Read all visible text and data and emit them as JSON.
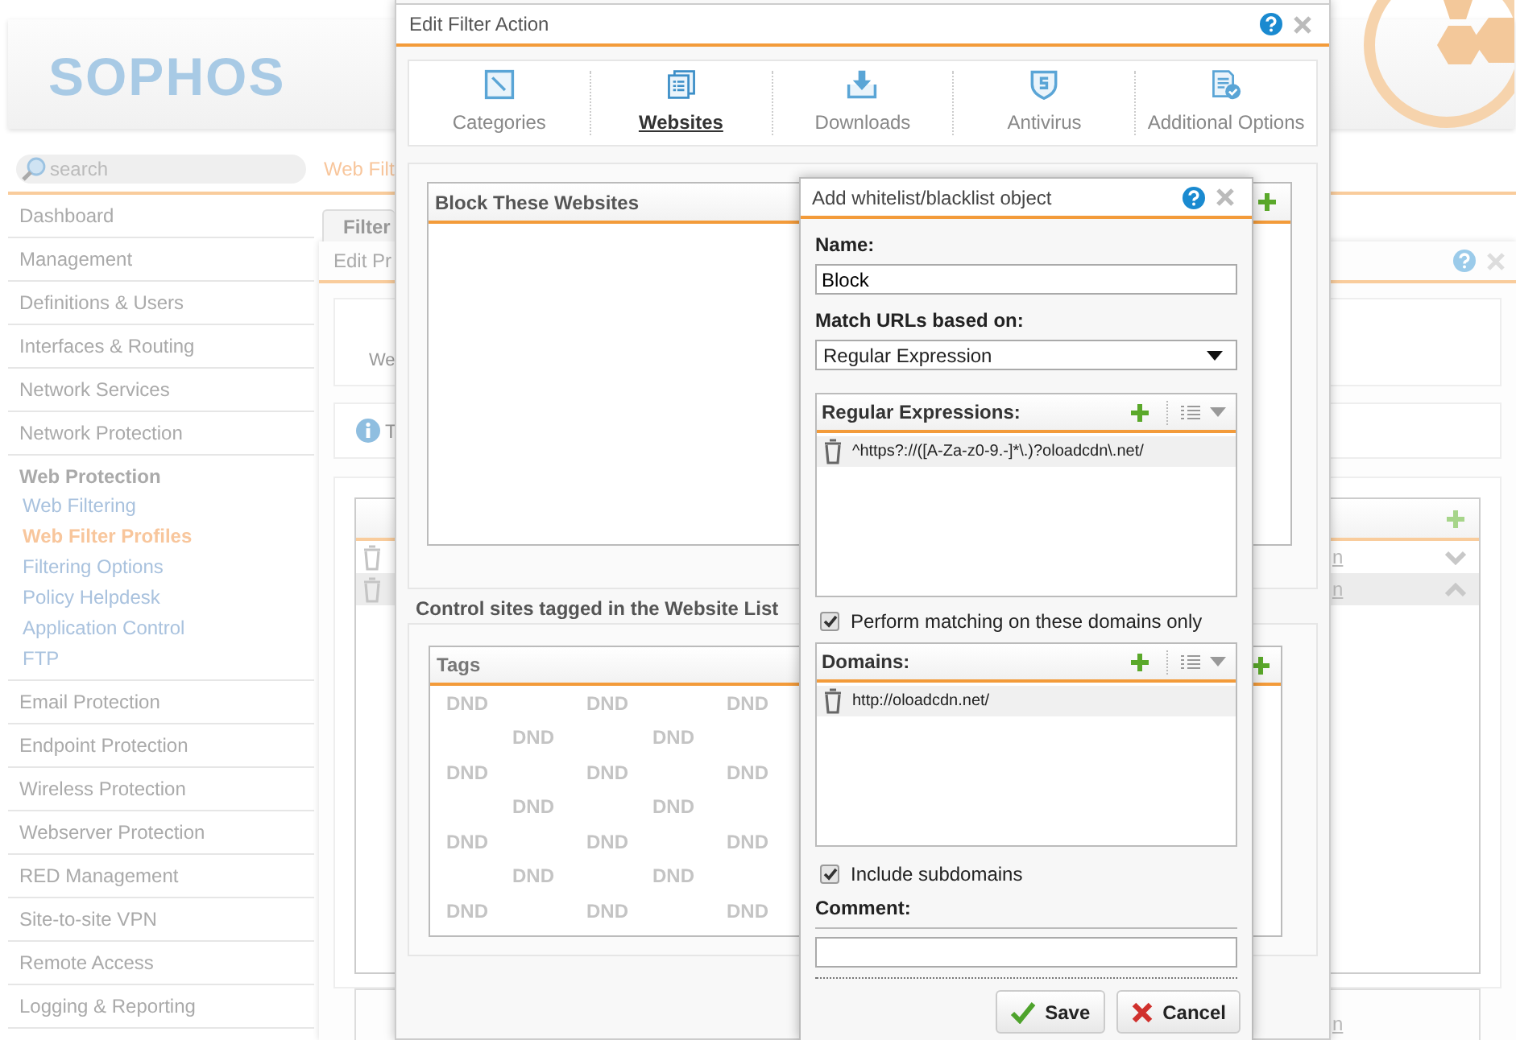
{
  "app": {
    "logo": "SOPHOS",
    "search": {
      "placeholder": "search"
    },
    "breadcrumb": "Web Filt",
    "sidebar": [
      {
        "label": "Dashboard",
        "expanded": false
      },
      {
        "label": "Management",
        "expanded": false
      },
      {
        "label": "Definitions & Users",
        "expanded": false
      },
      {
        "label": "Interfaces & Routing",
        "expanded": false
      },
      {
        "label": "Network Services",
        "expanded": false
      },
      {
        "label": "Network Protection",
        "expanded": false
      },
      {
        "label": "Web Protection",
        "expanded": true,
        "children": [
          {
            "label": "Web Filtering",
            "selected": false
          },
          {
            "label": "Web Filter Profiles",
            "selected": true
          },
          {
            "label": "Filtering Options",
            "selected": false
          },
          {
            "label": "Policy Helpdesk",
            "selected": false
          },
          {
            "label": "Application Control",
            "selected": false
          },
          {
            "label": "FTP",
            "selected": false
          }
        ]
      },
      {
        "label": "Email Protection",
        "expanded": false
      },
      {
        "label": "Endpoint Protection",
        "expanded": false
      },
      {
        "label": "Wireless Protection",
        "expanded": false
      },
      {
        "label": "Webserver Protection",
        "expanded": false
      },
      {
        "label": "RED Management",
        "expanded": false
      },
      {
        "label": "Site-to-site VPN",
        "expanded": false
      },
      {
        "label": "Remote Access",
        "expanded": false
      },
      {
        "label": "Logging & Reporting",
        "expanded": false
      }
    ]
  },
  "background_window": {
    "tab": "Filter",
    "title": "Edit Pr",
    "section_text": "We",
    "info_text": "T",
    "table": {
      "rows": [
        {
          "text": "n",
          "selected": false,
          "move_down": true,
          "move_up": false
        },
        {
          "text": "n",
          "selected": true,
          "move_down": false,
          "move_up": true
        }
      ]
    },
    "footer_text": "n"
  },
  "filter_dialog": {
    "title": "Edit Filter Action",
    "tabs": [
      {
        "label": "Categories",
        "kind": "categories",
        "selected": false
      },
      {
        "label": "Websites",
        "kind": "websites",
        "selected": true
      },
      {
        "label": "Downloads",
        "kind": "downloads",
        "selected": false
      },
      {
        "label": "Antivirus",
        "kind": "antivirus",
        "selected": false
      },
      {
        "label": "Additional Options",
        "kind": "options",
        "selected": false
      }
    ],
    "block_table": {
      "title": "Block These Websites"
    },
    "tags_heading": "Control sites tagged in the Website List",
    "tags_table": {
      "title": "Tags",
      "rows": [
        [
          "DND",
          "DND",
          "DND"
        ],
        [
          "DND",
          "DND"
        ],
        [
          "DND",
          "DND",
          "DND"
        ],
        [
          "DND",
          "DND"
        ],
        [
          "DND",
          "DND",
          "DND"
        ],
        [
          "DND",
          "DND"
        ],
        [
          "DND",
          "DND",
          "DND"
        ]
      ]
    }
  },
  "popup": {
    "title": "Add whitelist/blacklist object",
    "name_label": "Name:",
    "name_value": "Block",
    "match_label": "Match URLs based on:",
    "match_value": "Regular Expression",
    "regex_list": {
      "title": "Regular Expressions:",
      "items": [
        "^https?://([A-Za-z0-9.-]*\\.)?oloadcdn\\.net/"
      ]
    },
    "domains_only": {
      "label": "Perform matching on these domains only",
      "checked": true
    },
    "domains_list": {
      "title": "Domains:",
      "items": [
        "http://oloadcdn.net/"
      ]
    },
    "subdomains": {
      "label": "Include subdomains",
      "checked": true
    },
    "comment_label": "Comment:",
    "buttons": [
      {
        "label": "Save",
        "kind": "save"
      },
      {
        "label": "Cancel",
        "kind": "cancel"
      }
    ]
  }
}
